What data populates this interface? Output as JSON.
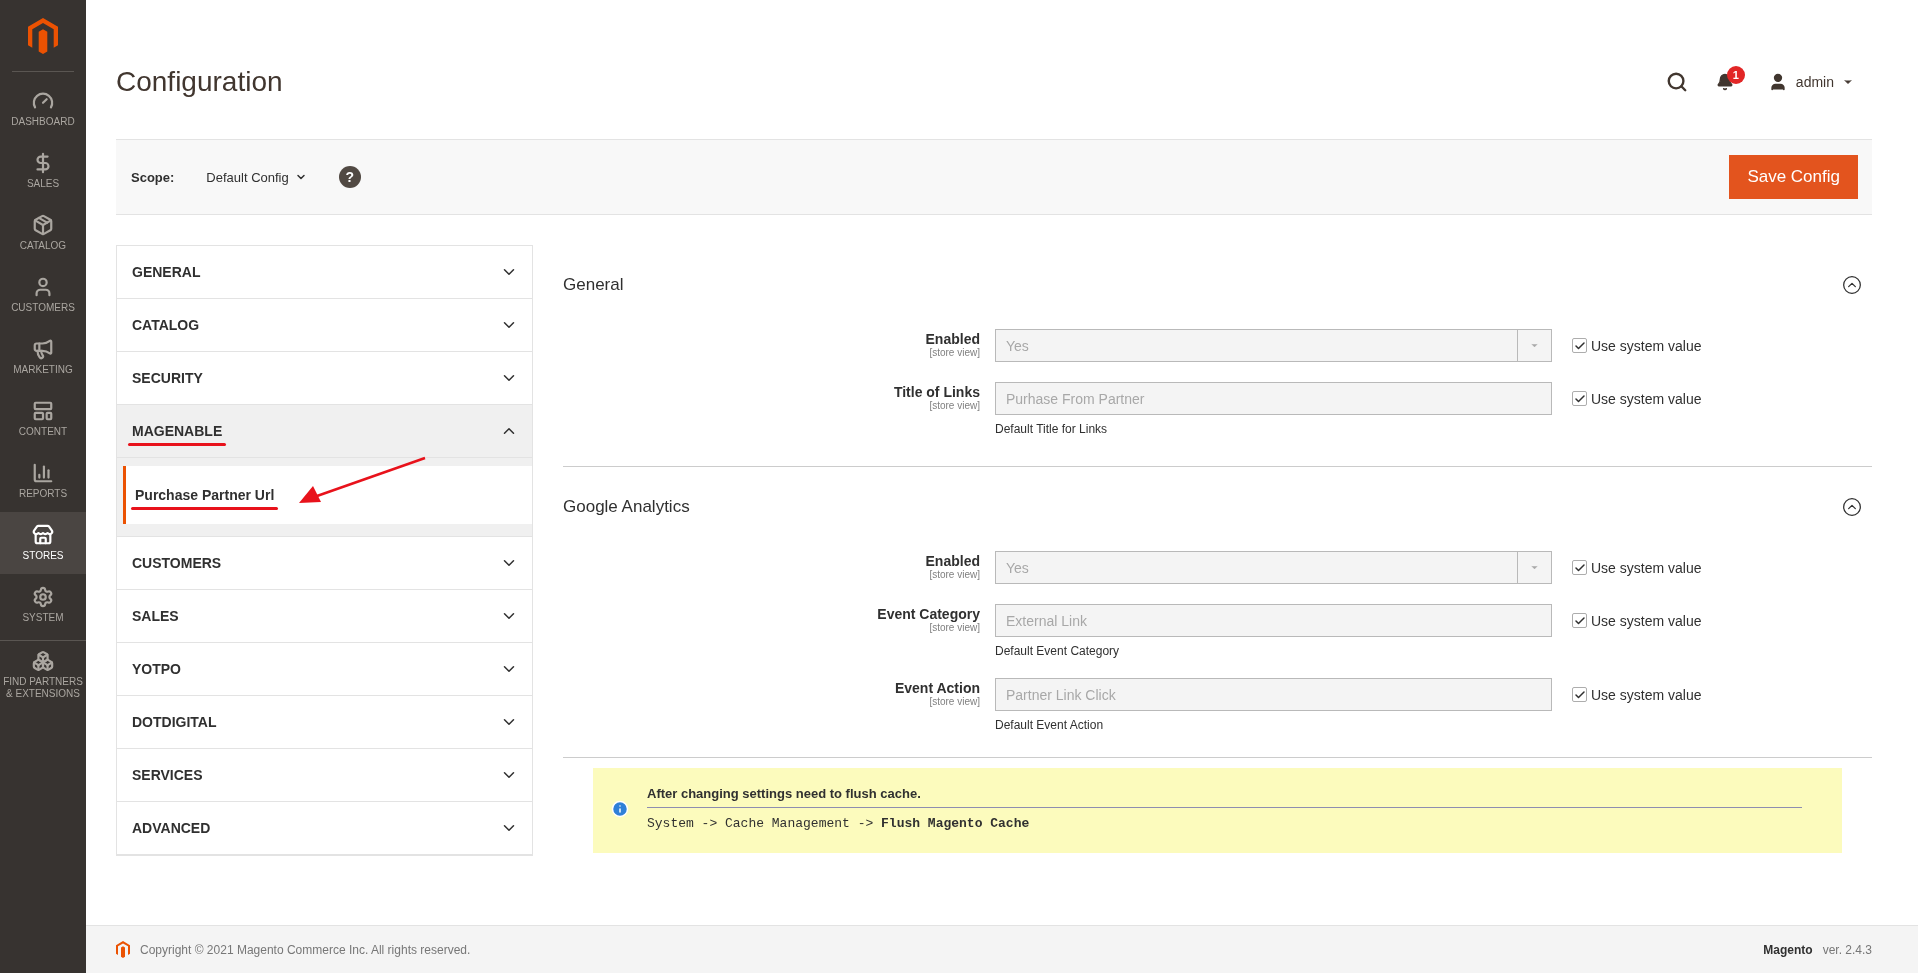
{
  "sidebar": {
    "items": [
      {
        "label": "DASHBOARD",
        "selected": false
      },
      {
        "label": "SALES",
        "selected": false
      },
      {
        "label": "CATALOG",
        "selected": false
      },
      {
        "label": "CUSTOMERS",
        "selected": false
      },
      {
        "label": "MARKETING",
        "selected": false
      },
      {
        "label": "CONTENT",
        "selected": false
      },
      {
        "label": "REPORTS",
        "selected": false
      },
      {
        "label": "STORES",
        "selected": true
      },
      {
        "label": "SYSTEM",
        "selected": false
      },
      {
        "label": "FIND PARTNERS & EXTENSIONS",
        "selected": false
      }
    ]
  },
  "page_title": "Configuration",
  "header": {
    "notifications": "1",
    "user": "admin"
  },
  "scope": {
    "label": "Scope:",
    "value": "Default Config",
    "help": "?"
  },
  "save_button": "Save Config",
  "config_nav": [
    {
      "label": "GENERAL",
      "expanded": false
    },
    {
      "label": "CATALOG",
      "expanded": false
    },
    {
      "label": "SECURITY",
      "expanded": false
    },
    {
      "label": "MAGENABLE",
      "expanded": true,
      "children": [
        {
          "label": "Purchase Partner Url",
          "selected": true
        }
      ]
    },
    {
      "label": "CUSTOMERS",
      "expanded": false
    },
    {
      "label": "SALES",
      "expanded": false
    },
    {
      "label": "YOTPO",
      "expanded": false
    },
    {
      "label": "DOTDIGITAL",
      "expanded": false
    },
    {
      "label": "SERVICES",
      "expanded": false
    },
    {
      "label": "ADVANCED",
      "expanded": false
    }
  ],
  "groups": [
    {
      "title": "General",
      "expanded": true,
      "fields": [
        {
          "kind": "select",
          "label": "Enabled",
          "scope": "[store view]",
          "value": "Yes",
          "disabled": true,
          "use_system_value": true,
          "checkbox_label": "Use system value"
        },
        {
          "kind": "text",
          "label": "Title of Links",
          "scope": "[store view]",
          "value": "Purhase From Partner",
          "note": "Default Title for Links",
          "disabled": true,
          "use_system_value": true,
          "checkbox_label": "Use system value"
        }
      ]
    },
    {
      "title": "Google Analytics",
      "expanded": true,
      "fields": [
        {
          "kind": "select",
          "label": "Enabled",
          "scope": "[store view]",
          "value": "Yes",
          "disabled": true,
          "use_system_value": true,
          "checkbox_label": "Use system value"
        },
        {
          "kind": "text",
          "label": "Event Category",
          "scope": "[store view]",
          "value": "External Link",
          "note": "Default Event Category",
          "disabled": true,
          "use_system_value": true,
          "checkbox_label": "Use system value"
        },
        {
          "kind": "text",
          "label": "Event Action",
          "scope": "[store view]",
          "value": "Partner Link Click",
          "note": "Default Event Action",
          "disabled": true,
          "use_system_value": true,
          "checkbox_label": "Use system value"
        }
      ]
    }
  ],
  "notice": {
    "title": "After changing settings need to flush cache.",
    "body": "System -> Cache Management -> **Flush Magento Cache**"
  },
  "footer": {
    "copyright": "Copyright © 2021 Magento Commerce Inc. All rights reserved.",
    "brand": "Magento",
    "version": "ver. 2.4.3"
  }
}
